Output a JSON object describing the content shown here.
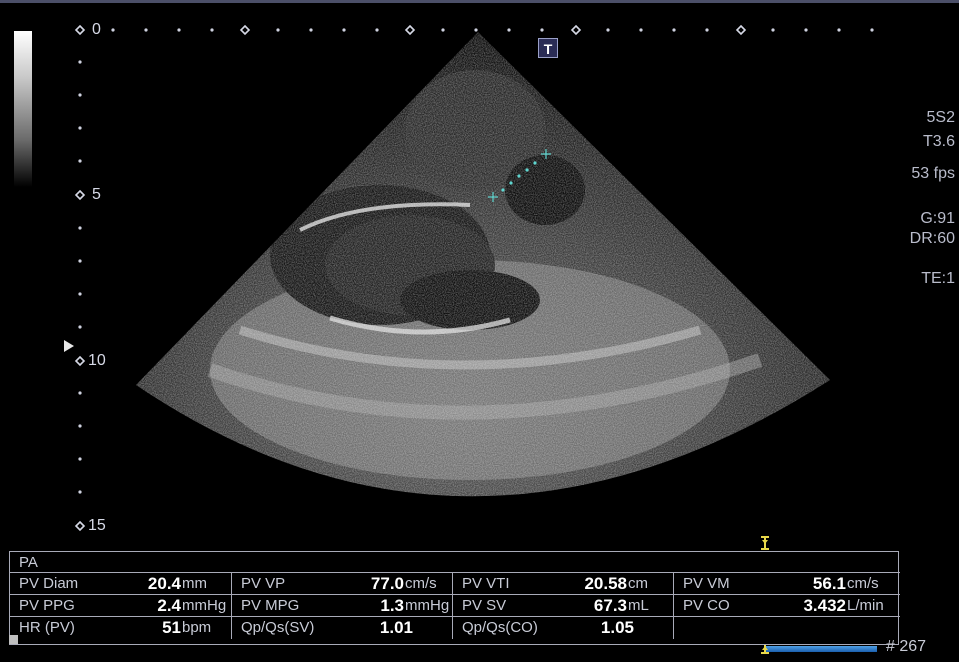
{
  "scale": {
    "depth_labels": [
      "0",
      "5",
      "10",
      "15"
    ]
  },
  "overlay": {
    "text_icon": "T"
  },
  "imaging_params": {
    "probe": "5S2",
    "harmonic": "T3.6",
    "frame_rate": "53 fps",
    "gain": "G:91",
    "dynamic_range": "DR:60",
    "te": "TE:1"
  },
  "measurements": {
    "title": "PA",
    "rows": [
      [
        {
          "label": "PV Diam",
          "value": "20.4",
          "unit": "mm"
        },
        {
          "label": "PV VP",
          "value": "77.0",
          "unit": "cm/s"
        },
        {
          "label": "PV VTI",
          "value": "20.58",
          "unit": "cm"
        },
        {
          "label": "PV VM",
          "value": "56.1",
          "unit": "cm/s"
        }
      ],
      [
        {
          "label": "PV PPG",
          "value": "2.4",
          "unit": "mmHg"
        },
        {
          "label": "PV MPG",
          "value": "1.3",
          "unit": "mmHg"
        },
        {
          "label": "PV SV",
          "value": "67.3",
          "unit": "mL"
        },
        {
          "label": "PV CO",
          "value": "3.432",
          "unit": "L/min"
        }
      ],
      [
        {
          "label": "HR (PV)",
          "value": "51",
          "unit": "bpm"
        },
        {
          "label": "Qp/Qs(SV)",
          "value": "1.01",
          "unit": ""
        },
        {
          "label": "Qp/Qs(CO)",
          "value": "1.05",
          "unit": ""
        },
        {
          "label": "",
          "value": "",
          "unit": ""
        }
      ]
    ]
  },
  "cine": {
    "frame_label": "# 267"
  },
  "colors": {
    "background": "#000000",
    "panel_border": "#a8aab8",
    "caliper": "#5fd6d0",
    "cine_bar": "#2a7fd0",
    "cine_marker": "#e8d84a"
  },
  "icons": [
    "grayscale-bar",
    "depth-pointer-icon",
    "text-annotation-icon",
    "caliper-cross-icon",
    "cine-marker-icon"
  ]
}
